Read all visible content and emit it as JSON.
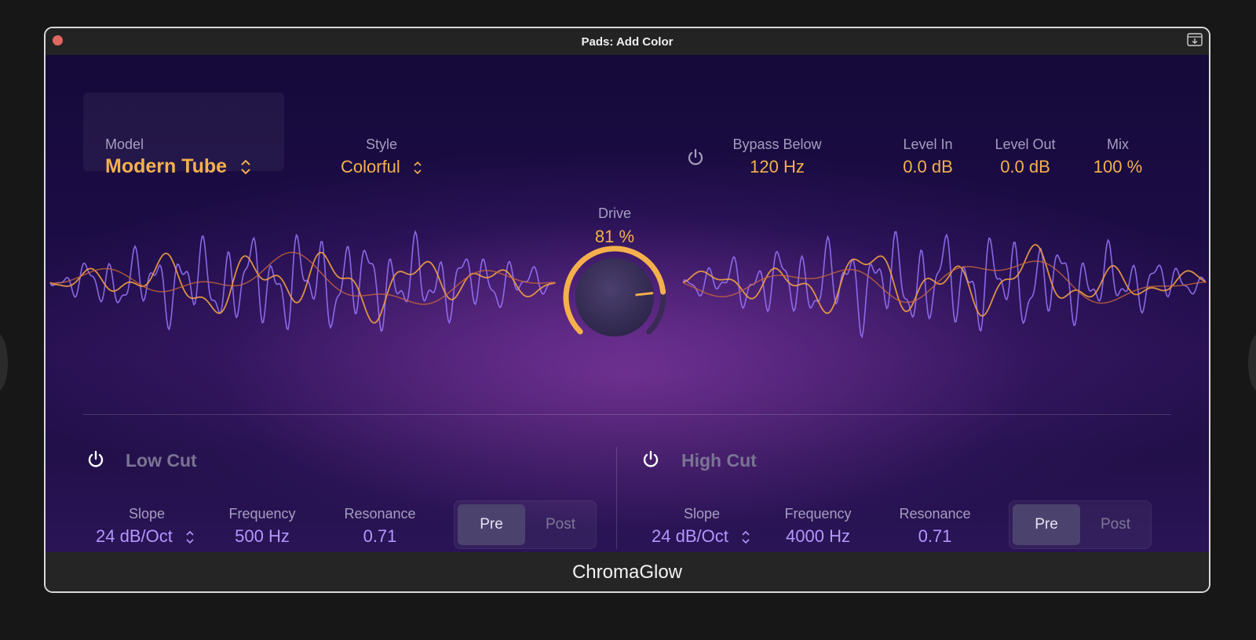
{
  "window": {
    "title": "Pads: Add Color",
    "plugin_name": "ChromaGlow"
  },
  "model": {
    "label": "Model",
    "value": "Modern Tube"
  },
  "style": {
    "label": "Style",
    "value": "Colorful"
  },
  "bypass": {
    "label": "Bypass Below",
    "value": "120 Hz"
  },
  "level_in": {
    "label": "Level In",
    "value": "0.0 dB"
  },
  "level_out": {
    "label": "Level Out",
    "value": "0.0 dB"
  },
  "mix": {
    "label": "Mix",
    "value": "100 %"
  },
  "drive": {
    "label": "Drive",
    "value": "81 %",
    "fraction": 0.81
  },
  "low_cut": {
    "title": "Low Cut",
    "slope": {
      "label": "Slope",
      "value": "24 dB/Oct"
    },
    "frequency": {
      "label": "Frequency",
      "value": "500 Hz"
    },
    "resonance": {
      "label": "Resonance",
      "value": "0.71"
    },
    "pre_label": "Pre",
    "post_label": "Post",
    "selected": "Pre"
  },
  "high_cut": {
    "title": "High Cut",
    "slope": {
      "label": "Slope",
      "value": "24 dB/Oct"
    },
    "frequency": {
      "label": "Frequency",
      "value": "4000 Hz"
    },
    "resonance": {
      "label": "Resonance",
      "value": "0.71"
    },
    "pre_label": "Pre",
    "post_label": "Post",
    "selected": "Pre"
  },
  "colors": {
    "accent_orange": "#f5b04d",
    "accent_purple": "#b596ff",
    "background": "#1a0f33",
    "wave_purple": "#9a78ff",
    "wave_orange": "#f0a040"
  },
  "icons": [
    "close-icon",
    "save-icon",
    "updown-chevron-icon",
    "power-icon",
    "drive-knob-icon"
  ]
}
